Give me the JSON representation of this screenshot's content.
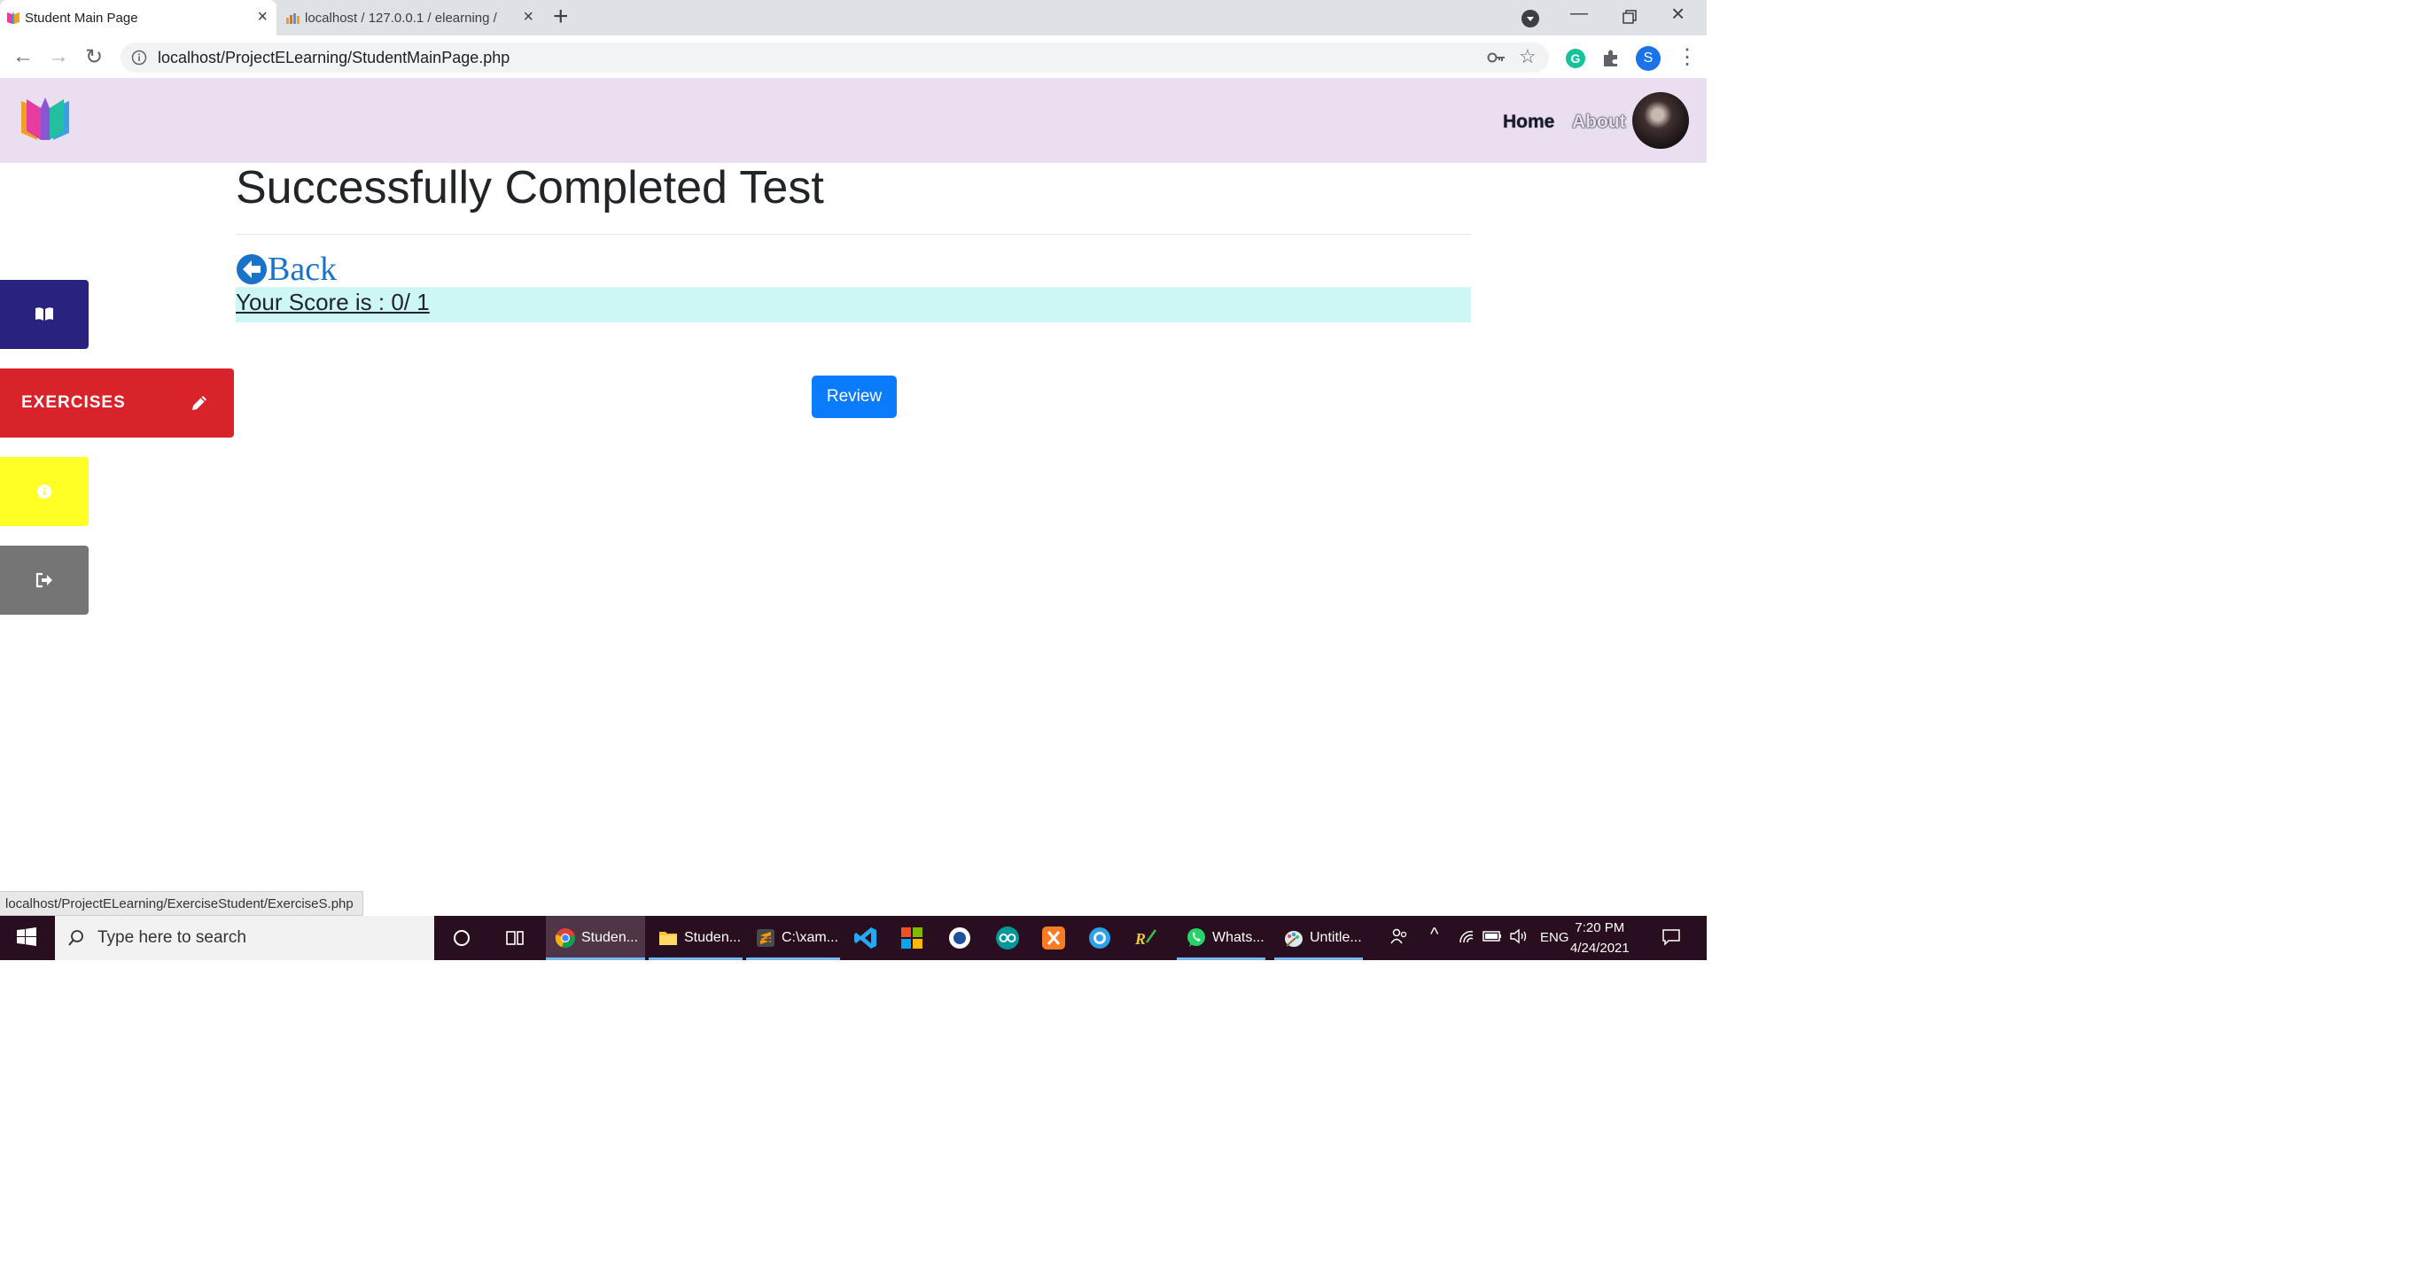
{
  "browser": {
    "tabs": [
      {
        "title": "Student Main Page",
        "active": true
      },
      {
        "title": "localhost / 127.0.0.1 / elearning /",
        "active": false
      }
    ],
    "url": "localhost/ProjectELearning/StudentMainPage.php",
    "profile_initial": "S"
  },
  "navbar": {
    "links": [
      "Home",
      "About"
    ]
  },
  "page": {
    "title": "Successfully Completed Test",
    "back_label": "Back",
    "score_text": "Your Score is : 0/ 1",
    "review_button": "Review"
  },
  "sidebar": {
    "items": [
      {
        "label": "",
        "icon": "book-icon",
        "color": "#29237f"
      },
      {
        "label": "EXERCISES",
        "icon": "pencil-icon",
        "color": "#d9232a"
      },
      {
        "label": "",
        "icon": "info-icon",
        "color": "#ffff26"
      },
      {
        "label": "",
        "icon": "sign-out-icon",
        "color": "#757575"
      }
    ]
  },
  "status_bar": {
    "link_preview": "localhost/ProjectELearning/ExerciseStudent/ExerciseS.php"
  },
  "taskbar": {
    "search_placeholder": "Type here to search",
    "apps": [
      {
        "label": "Studen...",
        "icon": "chrome-icon",
        "active": true
      },
      {
        "label": "Studen...",
        "icon": "file-explorer-icon",
        "active": false
      },
      {
        "label": "C:\\xam...",
        "icon": "sublime-text-icon",
        "active": false
      },
      {
        "label": "Whats...",
        "icon": "whatsapp-icon",
        "active": false
      },
      {
        "label": "Untitle...",
        "icon": "paint-icon",
        "active": false
      }
    ],
    "language": "ENG",
    "time": "7:20 PM",
    "date": "4/24/2021"
  }
}
